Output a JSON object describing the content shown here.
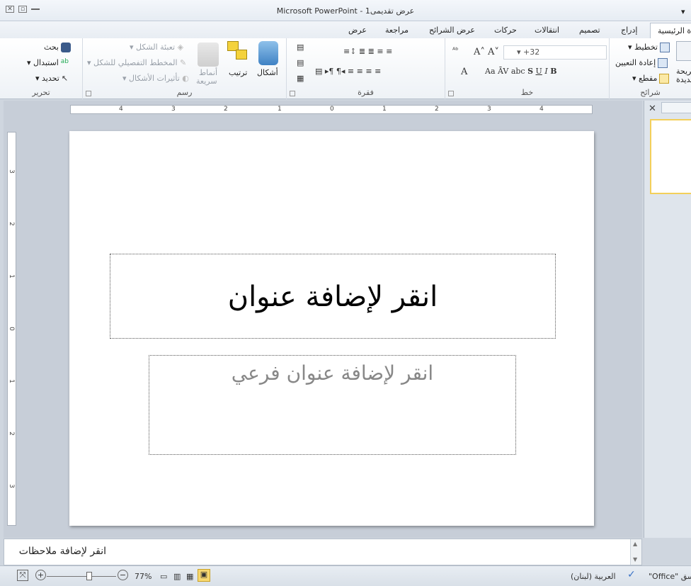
{
  "window": {
    "title": "Microsoft PowerPoint - عرض تقديمى1"
  },
  "tabs": [
    {
      "id": "home",
      "label": "ة الرئيسية",
      "active": true
    },
    {
      "id": "insert",
      "label": "إدراج"
    },
    {
      "id": "design",
      "label": "تصميم"
    },
    {
      "id": "transitions",
      "label": "انتقالات"
    },
    {
      "id": "animations",
      "label": "حركات"
    },
    {
      "id": "slideshow",
      "label": "عرض الشرائح"
    },
    {
      "id": "review",
      "label": "مراجعة"
    },
    {
      "id": "view",
      "label": "عرض"
    }
  ],
  "ribbon": {
    "slides": {
      "label": "شرائح",
      "layout": "تخطيط",
      "reset": "إعادة التعيين",
      "section": "مقطع",
      "new_slide": "شريحة",
      "new_slide2": "جديدة"
    },
    "font": {
      "label": "خط",
      "size": "+32"
    },
    "paragraph": {
      "label": "فقرة"
    },
    "drawing": {
      "label": "رسم",
      "shapes": "أشكال",
      "arrange": "ترتيب",
      "quick_styles": "أنماط",
      "quick_styles2": "سريعة",
      "fill": "تعبئة الشكل",
      "outline": "المخطط التفصيلي للشكل",
      "effects": "تأثيرات الأشكال"
    },
    "editing": {
      "label": "تحرير",
      "find": "بحث",
      "replace": "استبدال",
      "select": "تحديد"
    }
  },
  "ruler": {
    "h_labels": [
      "4",
      "3",
      "2",
      "1",
      "0",
      "1",
      "2",
      "3",
      "4"
    ],
    "v_labels": [
      "3",
      "2",
      "1",
      "0",
      "1",
      "2",
      "3"
    ]
  },
  "slide": {
    "title_placeholder": "انقر لإضافة عنوان",
    "subtitle_placeholder": "انقر لإضافة عنوان فرعي"
  },
  "notes": {
    "placeholder": "انقر لإضافة ملاحظات"
  },
  "status": {
    "theme": "\"Office\" سق",
    "language": "العربية (لبنان)",
    "zoom": "77%"
  },
  "colors": {
    "accent": "#3a73c6",
    "thumb_border": "#f3cf5a"
  },
  "icons": [
    "close-icon",
    "restore-icon",
    "minimize-icon",
    "help-icon",
    "binoculars-icon",
    "replace-icon",
    "cursor-icon",
    "shapes-icon",
    "arrange-icon",
    "quick-styles-icon",
    "layout-icon",
    "new-slide-icon",
    "fit-icon",
    "zoom-in-icon",
    "zoom-out-icon",
    "normal-view-icon",
    "sorter-view-icon",
    "reading-view-icon",
    "slideshow-view-icon",
    "spellcheck-icon"
  ]
}
